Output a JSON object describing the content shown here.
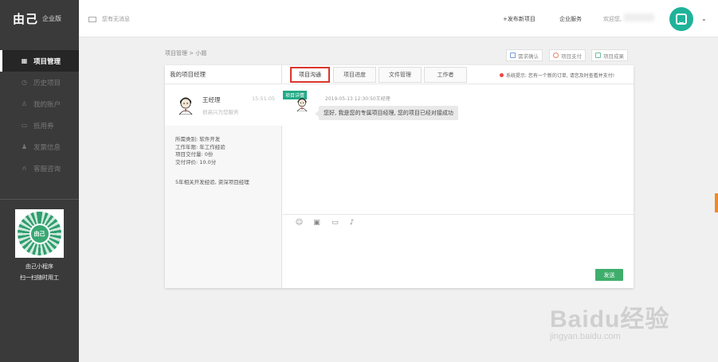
{
  "sidebar": {
    "logo": "由己",
    "edition": "企业版",
    "items": [
      {
        "label": "项目管理",
        "icon": "grid-icon",
        "active": true
      },
      {
        "label": "历史项目",
        "icon": "history-icon",
        "active": false
      },
      {
        "label": "我的账户",
        "icon": "account-icon",
        "active": false
      },
      {
        "label": "抵用券",
        "icon": "coupon-icon",
        "active": false
      },
      {
        "label": "发票信息",
        "icon": "invoice-icon",
        "active": false
      },
      {
        "label": "客服咨询",
        "icon": "headset-icon",
        "active": false
      }
    ],
    "qr_center": "由己",
    "qr_caption_1": "由己小程序",
    "qr_caption_2": "扫一扫随时用工"
  },
  "topbar": {
    "message": "您有无消息",
    "publish": "+发布新项目",
    "service": "企业服务",
    "welcome": "欢迎您,"
  },
  "breadcrumb": "项目管理 > 小题",
  "actions": [
    {
      "label": "需求确认",
      "icon": "clipboard-icon",
      "color": "#7a9bd8"
    },
    {
      "label": "项目支付",
      "icon": "payment-icon",
      "color": "#e5826b"
    },
    {
      "label": "项目成果",
      "icon": "result-icon",
      "color": "#6fbf9b"
    }
  ],
  "left": {
    "title": "我的项目经理",
    "manager_name": "王经理",
    "manager_time": "15:51:05",
    "manager_sub": "很高兴为您服务",
    "info": [
      "所需类别: 软件开发",
      "工作年限: 年工作经验",
      "项目交付量: 0份",
      "交付评价: 10.0分"
    ],
    "bio": "5年相关开发经验, 资深项目经理"
  },
  "tabs": [
    "项目沟通",
    "项目进度",
    "文件管理",
    "工作者"
  ],
  "notice": "系统提示: 您有一个新的订单, 请您及时查看并支付!",
  "chat": {
    "tag": "项目详情",
    "meta": "2019-05-13 12:30:50王经理",
    "bubble": "您好, 我是您的专属项目经理, 您的项目已经对接成功"
  },
  "composer_tools": [
    "emoji-icon",
    "image-icon",
    "folder-icon",
    "mic-icon"
  ],
  "send_label": "发送",
  "watermark": {
    "main": "Bai",
    "main2": "du",
    "cn": "经验",
    "sub": "jingyan.baidu.com"
  },
  "colors": {
    "accent": "#d9362b",
    "green": "#3fae6c",
    "teal": "#22a985",
    "avatar": "#1fb39a"
  }
}
